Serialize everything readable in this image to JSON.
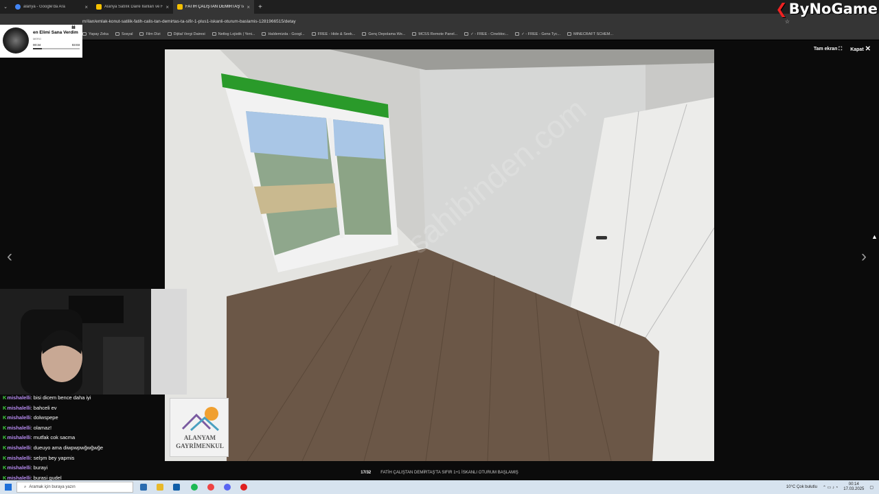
{
  "tabs": [
    {
      "label": "alanya - Google'da Ara",
      "color": "#4285f4"
    },
    {
      "label": "Alanya Satılık Daire İlanları ve Fiyatları",
      "color": "#f5c000"
    },
    {
      "label": "FATİH ÇALIŞTAN DEMİRTAŞ'TA",
      "color": "#f5c000",
      "active": true
    }
  ],
  "url": "m/ilan/emlak-konut-satilik-fatih-calis-tan-demirtas-ta-sifir-1-plus1-iskanli-oturum-baslamis-1281966515/detay",
  "bookmarks": [
    "Yapay Zeka",
    "Sosyal",
    "Film Dizi",
    "Dijital Vergi Dairesi",
    "Netlog Lojistik | Yeni...",
    "Haldemizda - Googl...",
    "FREE - Hide & Seek...",
    "Genç Depolama We...",
    "MCSS Remote Panel...",
    "✓ - FREE - Cinebloc...",
    "✓ - FREE - Gens Tyc...",
    "MINECRAFT SCHEM..."
  ],
  "music": {
    "song": "en Elimi Sana Verdim",
    "artist": "MERO",
    "elapsed": "00:34",
    "total": "03:03",
    "progress": 0.19
  },
  "viewer": {
    "fullscreen": "Tam ekran",
    "close": "Kapat",
    "counter": "17/32",
    "caption": "FATİH ÇALIŞTAN DEMİRTAŞ'TA SIFIR 1+1 İSKANLI OTURUM BAŞLAMIŞ",
    "prev_icon": "chevron-left-icon",
    "next_icon": "chevron-right-icon",
    "watermark": "sahibinden.com"
  },
  "chat": [
    {
      "user": "mishalelli",
      "msg": "bisi dicem bence daha iyi"
    },
    {
      "user": "mishalelli",
      "msg": "bahceli ev"
    },
    {
      "user": "mishalelli",
      "msg": "dolwspepe"
    },
    {
      "user": "mishalelli",
      "msg": "olamaz!"
    },
    {
      "user": "mishalelli",
      "msg": "mutfak cok sacma"
    },
    {
      "user": "mishalelli",
      "msg": "dueuyo ama diwpwpwğwğwğe"
    },
    {
      "user": "mishalelli",
      "msg": "selşm bey yapmis"
    },
    {
      "user": "mishalelli",
      "msg": "burayi"
    },
    {
      "user": "mishalelli",
      "msg": "burasi gudel"
    }
  ],
  "realty_logo": {
    "line1": "ALANYAM",
    "line2": "GAYRİMENKUL"
  },
  "brand": "ByNoGame",
  "taskbar": {
    "search_placeholder": "Aramak için buraya yazın",
    "weather": "10°C  Çok bulutlu",
    "time": "00:14",
    "date": "17.03.2025"
  },
  "colors": {
    "chat_user": "#b88cf2",
    "brand_mark": "#e22",
    "tab_active": "#353535"
  }
}
